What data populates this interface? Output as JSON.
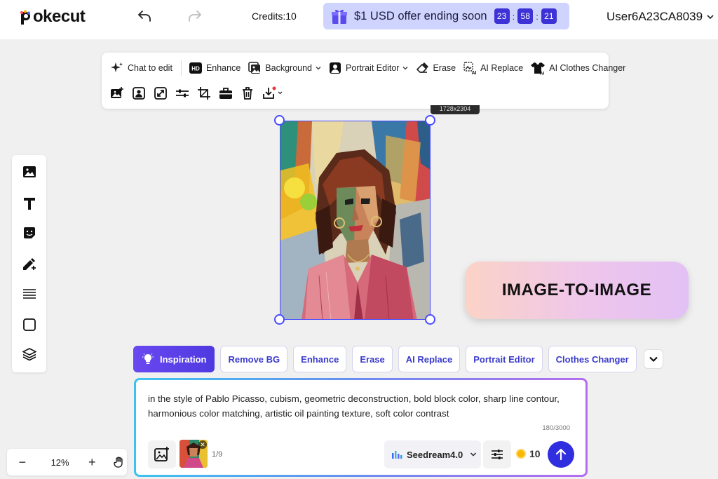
{
  "app": {
    "logo_text": "okecut"
  },
  "header": {
    "credits_label": "Credits:10",
    "offer_text": "$1 USD offer ending soon",
    "countdown": [
      "23",
      "58",
      "21"
    ],
    "user_name": "User6A23CA8039"
  },
  "toolbar": {
    "row1": [
      {
        "label": "Chat to edit",
        "icon": "sparkle-icon"
      },
      {
        "label": "Enhance",
        "icon": "hd-icon"
      },
      {
        "label": "Background",
        "icon": "background-icon",
        "dropdown": true
      },
      {
        "label": "Portrait Editor",
        "icon": "portrait-icon",
        "dropdown": true
      },
      {
        "label": "Erase",
        "icon": "eraser-icon"
      },
      {
        "label": "AI Replace",
        "icon": "ai-replace-icon"
      },
      {
        "label": "AI Clothes Changer",
        "icon": "shirt-icon"
      }
    ],
    "row2_icons": [
      "add-image-icon",
      "portrait-frame-icon",
      "expand-icon",
      "adjust-icon",
      "crop-icon",
      "toolbox-icon",
      "trash-icon",
      "download-icon"
    ]
  },
  "canvas": {
    "size_tag": "1728x2304"
  },
  "left_tools": [
    "image-icon",
    "text-icon",
    "sticker-icon",
    "draw-icon",
    "lines-icon",
    "shape-icon",
    "layers-icon"
  ],
  "overlay_label": "IMAGE-TO-IMAGE",
  "chips": {
    "primary": "Inspiration",
    "items": [
      "Remove BG",
      "Enhance",
      "Erase",
      "AI Replace",
      "Portrait Editor",
      "Clothes Changer"
    ]
  },
  "prompt": {
    "text": "in the style of Pablo Picasso, cubism, geometric deconstruction, bold block color, sharp line contour, harmonious color matching, artistic oil painting texture, soft color contrast",
    "counter": "180/3000",
    "page": "1/9",
    "model": "Seedream4.0",
    "cost": "10"
  },
  "zoom": {
    "value": "12%",
    "minus": "−",
    "plus": "+"
  },
  "colors": {
    "accent": "#3d32d6",
    "offer_bg": "#cfd4ff",
    "chip_text": "#3b3bcc",
    "send": "#2f2fe0"
  }
}
